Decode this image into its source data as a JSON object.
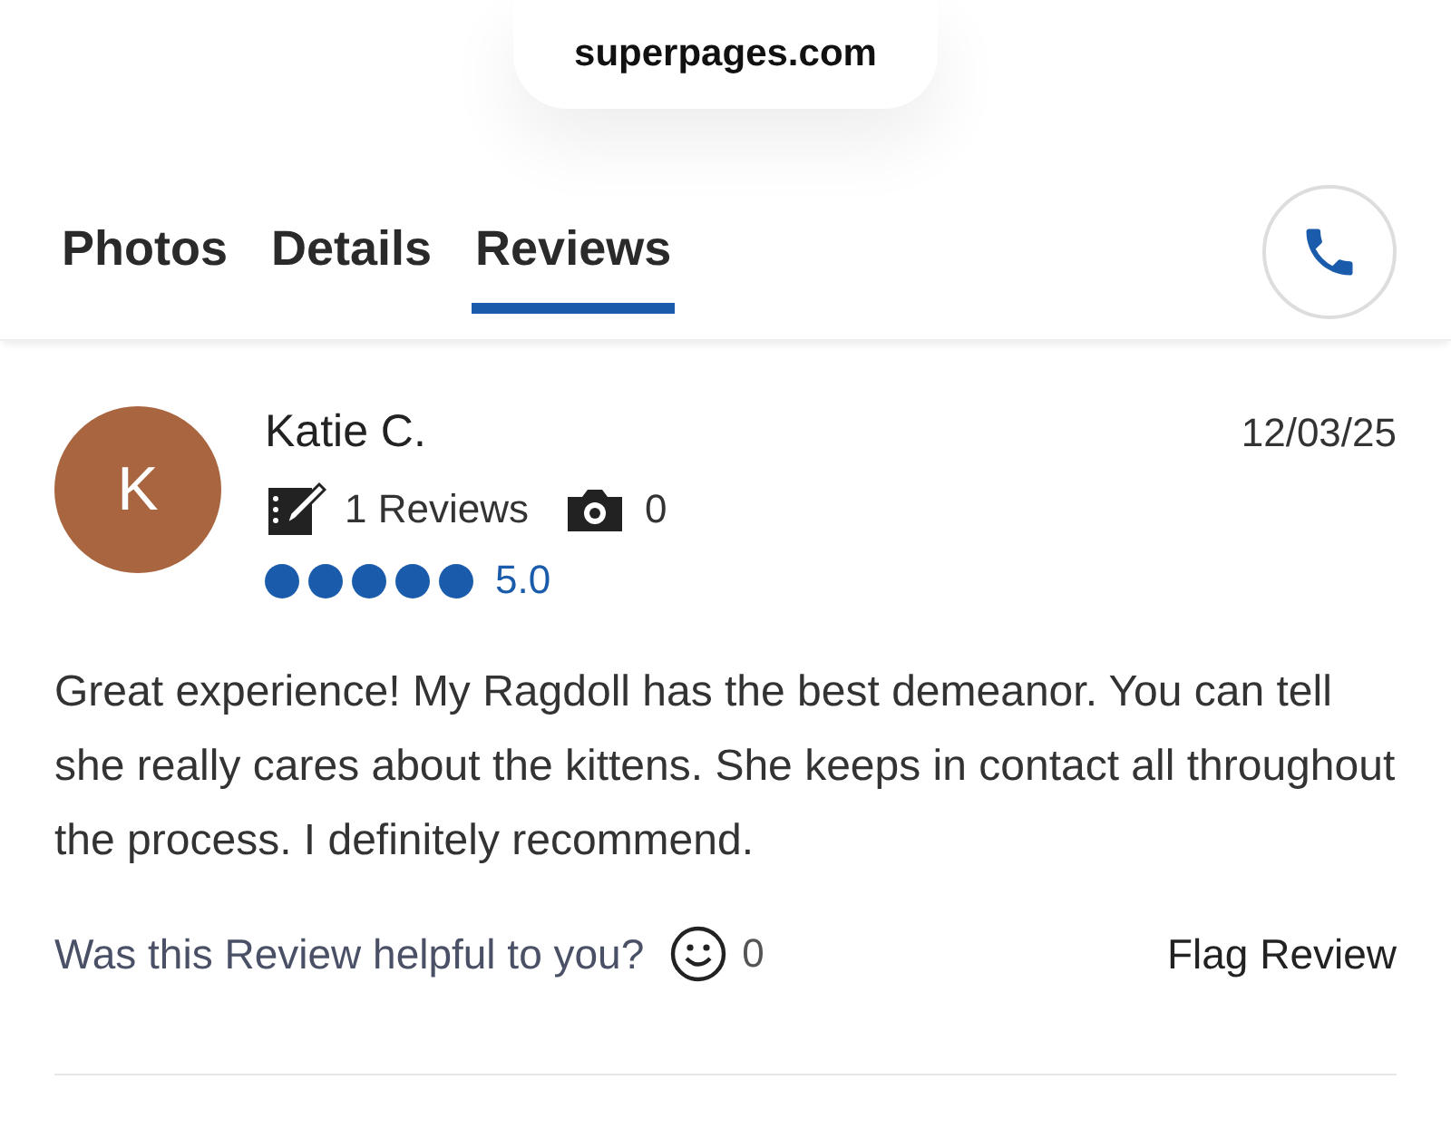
{
  "address_bar": {
    "url": "superpages.com"
  },
  "tabs": [
    {
      "label": "Photos",
      "selected": false
    },
    {
      "label": "Details",
      "selected": false
    },
    {
      "label": "Reviews",
      "selected": true
    }
  ],
  "review": {
    "avatar_letter": "K",
    "author": "Katie C.",
    "date": "12/03/25",
    "reviews_count": "1 Reviews",
    "photos_count": "0",
    "stars": 5,
    "rating": "5.0",
    "text": "Great experience! My Ragdoll has the best demeanor. You can tell she really cares about the kittens. She keeps in contact all throughout the process. I definitely recommend.",
    "helpful_prompt": "Was this Review helpful to you?",
    "helpful_count": "0",
    "flag_label": "Flag Review"
  }
}
